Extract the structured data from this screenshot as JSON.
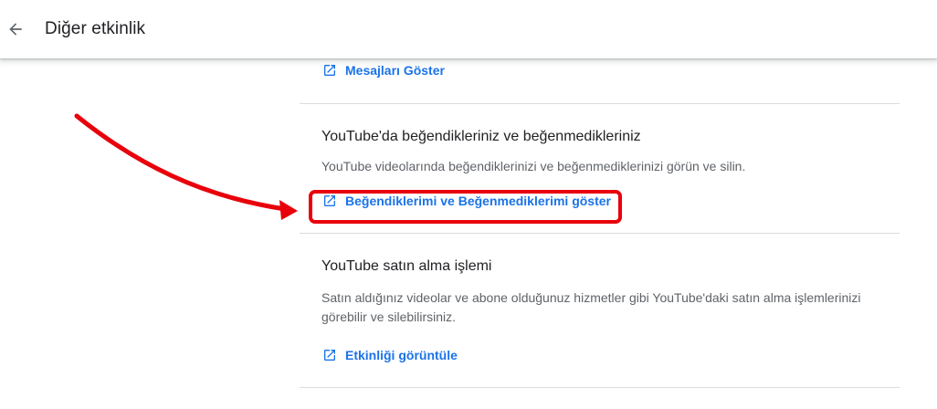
{
  "header": {
    "back_icon": "arrow-left-icon",
    "title": "Diğer etkinlik"
  },
  "sections": {
    "messages": {
      "link_label": "Mesajları Göster",
      "link_icon": "open-in-new-icon"
    },
    "likes": {
      "title": "YouTube'da beğendikleriniz ve beğenmedikleriniz",
      "description": "YouTube videolarında beğendiklerinizi ve beğenmediklerinizi görün ve silin.",
      "link_label": "Beğendiklerimi ve Beğenmediklerimi göster",
      "link_icon": "open-in-new-icon"
    },
    "purchases": {
      "title": "YouTube satın alma işlemi",
      "description_line1": "Satın aldığınız videolar ve abone olduğunuz hizmetler gibi YouTube'daki satın alma işlemlerinizi",
      "description_line2": "görebilir ve silebilirsiniz.",
      "link_label": "Etkinliği görüntüle",
      "link_icon": "open-in-new-icon"
    }
  },
  "colors": {
    "link": "#1a73e8",
    "title_text": "#202124",
    "secondary_text": "#5f6368",
    "divider": "#dadce0",
    "annotation_red": "#e8000b"
  }
}
